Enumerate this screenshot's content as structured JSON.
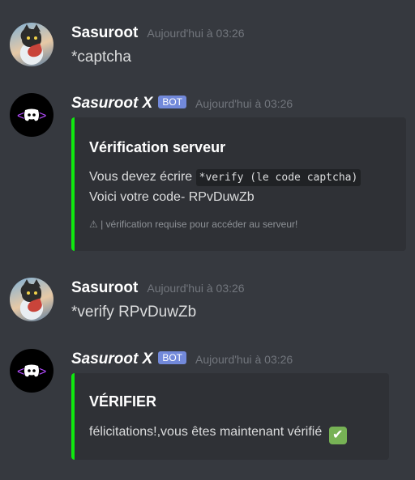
{
  "messages": [
    {
      "author": "Sasuroot",
      "timestamp": "Aujourd'hui à 03:26",
      "content": "*captcha"
    },
    {
      "author": "Sasuroot X",
      "bot_tag": "BOT",
      "timestamp": "Aujourd'hui à 03:26",
      "embed": {
        "title": "Vérification serveur",
        "line1_text": "Vous devez écrire",
        "line1_code": "*verify (le code captcha)",
        "line2": "Voici votre code- RPvDuwZb",
        "footer": "⚠ | vérification requise pour accéder au serveur!",
        "accent_color": "#10e80f"
      }
    },
    {
      "author": "Sasuroot",
      "timestamp": "Aujourd'hui à 03:26",
      "content": "*verify RPvDuwZb"
    },
    {
      "author": "Sasuroot X",
      "bot_tag": "BOT",
      "timestamp": "Aujourd'hui à 03:26",
      "embed": {
        "title": "VÉRIFIER",
        "description": "félicitations!,vous êtes maintenant vérifié",
        "emoji": "✔",
        "accent_color": "#10e80f"
      }
    }
  ],
  "colors": {
    "background": "#36393f",
    "embed_background": "#2f3136",
    "bot_tag": "#7289da",
    "timestamp": "#72767d"
  }
}
